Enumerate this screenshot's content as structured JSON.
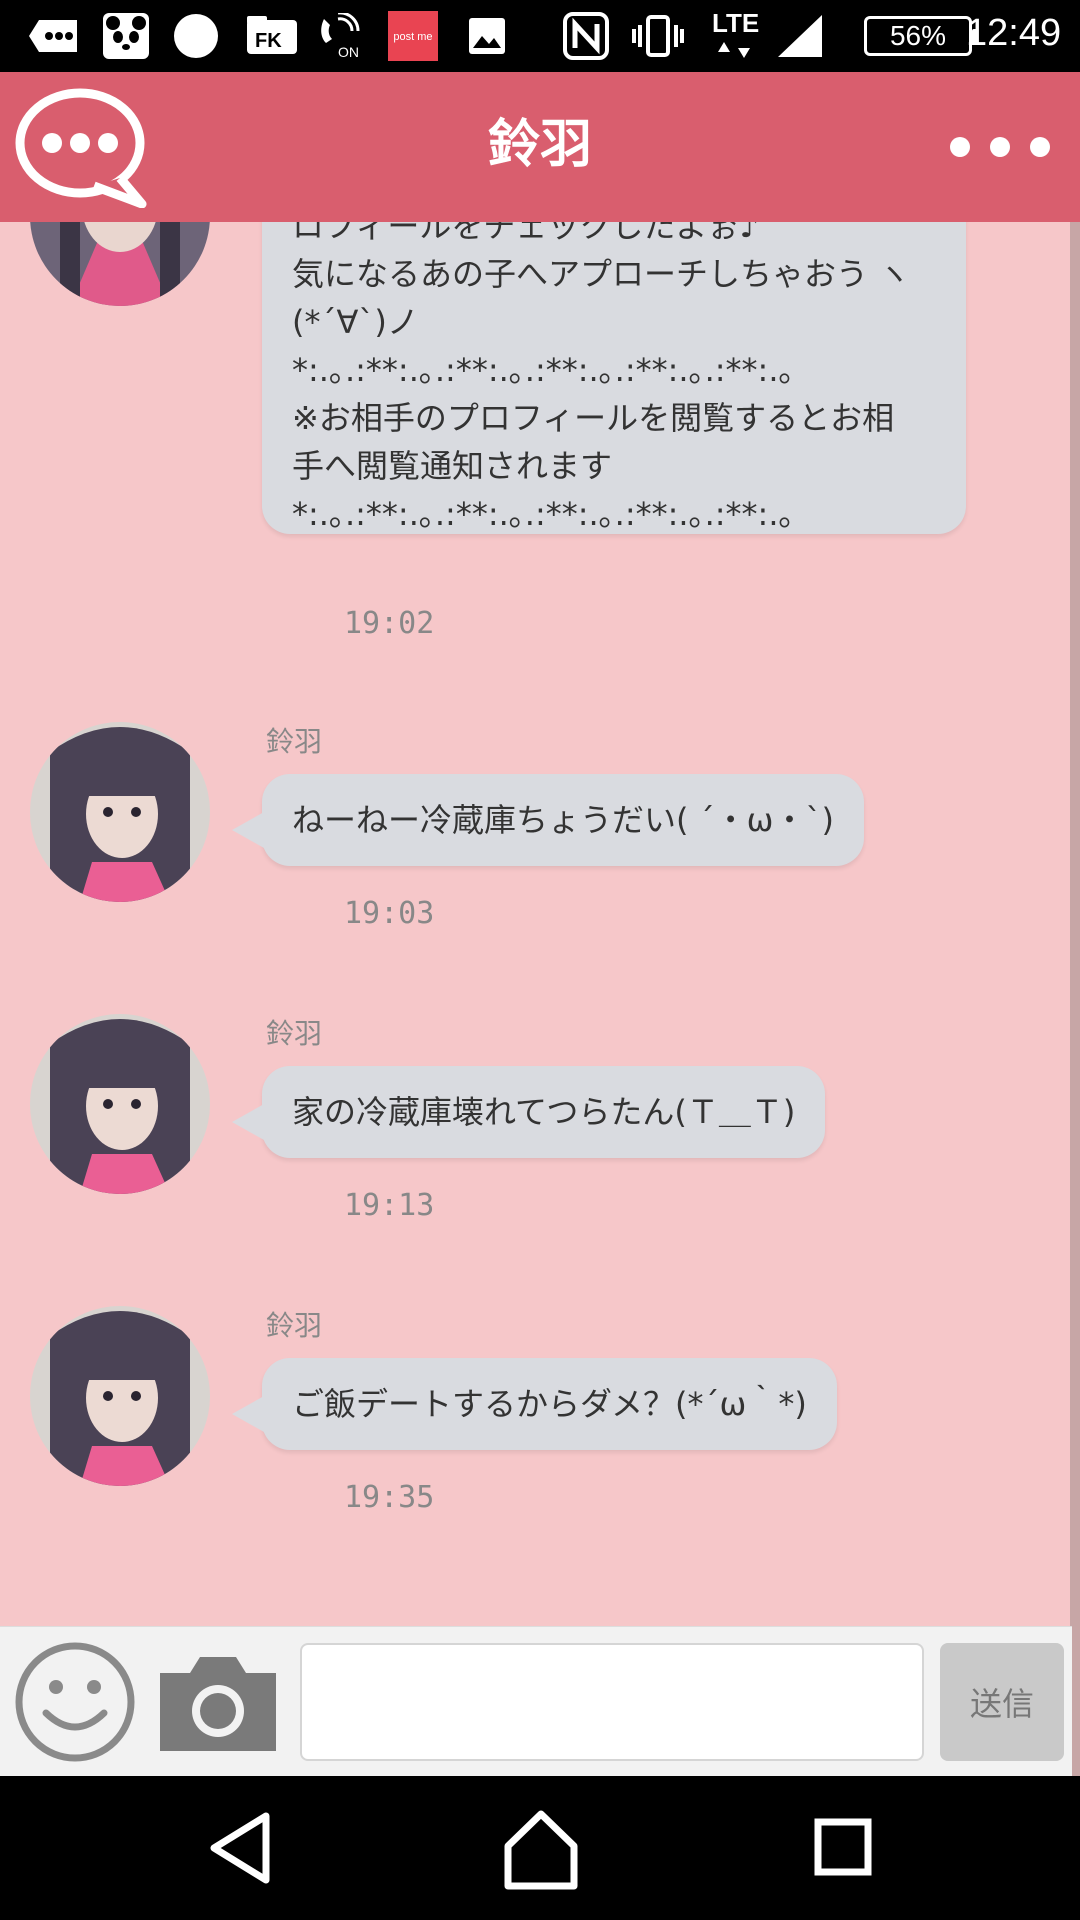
{
  "status_bar": {
    "time": "12:49",
    "battery": "56%",
    "network": "LTE",
    "icons": [
      "message-icon",
      "panda-app-icon",
      "circle-app-icon",
      "fk-app-icon",
      "wifi-calling-icon",
      "postme-app-icon",
      "gallery-icon",
      "nfc-icon",
      "vibrate-icon",
      "signal-icon"
    ],
    "postme_label": "post me",
    "fk_label": "FK",
    "on_label": "ON"
  },
  "header": {
    "title": "鈴羽",
    "logo": "chat-bubble-logo-icon",
    "menu": "more-options-icon"
  },
  "messages": [
    {
      "sender": "",
      "text": "ロフィールをチェックしたよぉ♪\n気になるあの子へアプローチしちゃおう ヽ\n(*´∀`)ノ\n*:.｡.:**:.｡.:**:.｡.:**:.｡.:**:.｡.:**:.｡\n※お相手のプロフィールを閲覧するとお相\n手へ閲覧通知されます\n*:.｡.:**:.｡.:**:.｡.:**:.｡.:**:.｡.:**:.｡",
      "time": "19:02"
    },
    {
      "sender": "鈴羽",
      "text": "ねーねー冷蔵庫ちょうだい( ´・ω・`)",
      "time": "19:03"
    },
    {
      "sender": "鈴羽",
      "text": "家の冷蔵庫壊れてつらたん(Ｔ＿Ｔ)",
      "time": "19:13"
    },
    {
      "sender": "鈴羽",
      "text": "ご飯デートするからダメ？(*´ω｀*)",
      "time": "19:35"
    }
  ],
  "input_bar": {
    "emoji_icon": "smiley-icon",
    "camera_icon": "camera-icon",
    "placeholder": "",
    "send_label": "送信"
  },
  "nav_bar": {
    "icons": [
      "back-icon",
      "home-icon",
      "recents-icon"
    ]
  },
  "colors": {
    "header": "#d95e6e",
    "background": "#f6c7c9",
    "bubble": "#d9dbe0"
  }
}
